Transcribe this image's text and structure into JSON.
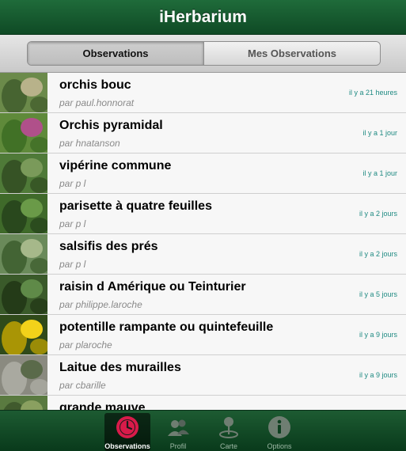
{
  "app": {
    "title": "iHerbarium"
  },
  "segments": {
    "observations": "Observations",
    "mine": "Mes Observations"
  },
  "observations": [
    {
      "name": "orchis bouc",
      "author": "par paul.honnorat",
      "time": "il y a 21 heures",
      "thumb_colors": [
        "#6b8a4a",
        "#b8b28a",
        "#3f5a2a"
      ]
    },
    {
      "name": "Orchis pyramidal",
      "author": "par hnatanson",
      "time": "il y a 1 jour",
      "thumb_colors": [
        "#5f8a3a",
        "#b0508a",
        "#3a6a22"
      ]
    },
    {
      "name": "vipérine commune",
      "author": "par p l",
      "time": "il y a 1 jour",
      "thumb_colors": [
        "#4f7a38",
        "#7a9a5a",
        "#2f4a20"
      ]
    },
    {
      "name": "parisette à quatre feuilles",
      "author": "par p l",
      "time": "il y a 2 jours",
      "thumb_colors": [
        "#3f6a2a",
        "#6a9a48",
        "#24401a"
      ]
    },
    {
      "name": "salsifis des prés",
      "author": "par p l",
      "time": "il y a 2 jours",
      "thumb_colors": [
        "#6a8a5a",
        "#a6b88a",
        "#3a5a2a"
      ]
    },
    {
      "name": "raisin d Amérique ou Teinturier",
      "author": "par philippe.laroche",
      "time": "il y a 5 jours",
      "thumb_colors": [
        "#3a5a2a",
        "#5f8a48",
        "#1f3314"
      ]
    },
    {
      "name": "potentille rampante ou quintefeuille",
      "author": "par plaroche",
      "time": "il y a 9 jours",
      "thumb_colors": [
        "#2f4a1a",
        "#f2d21a",
        "#c8a800"
      ]
    },
    {
      "name": "Laitue des murailles",
      "author": "par cbarille",
      "time": "il y a 9 jours",
      "thumb_colors": [
        "#8a8a80",
        "#5a6a4a",
        "#b0b0a8"
      ]
    },
    {
      "name": "grande mauve",
      "author": "",
      "time": "",
      "thumb_colors": [
        "#5a7a40",
        "#8aa060",
        "#3a5228"
      ]
    }
  ],
  "tabs": [
    {
      "label": "Observations",
      "icon": "clock-icon"
    },
    {
      "label": "Profil",
      "icon": "people-icon"
    },
    {
      "label": "Carte",
      "icon": "map-pin-icon"
    },
    {
      "label": "Options",
      "icon": "info-icon"
    }
  ],
  "colors": {
    "brand_green": "#0f4a25",
    "time_teal": "#1f8a82",
    "active_tab_accent": "#d81b4a"
  }
}
